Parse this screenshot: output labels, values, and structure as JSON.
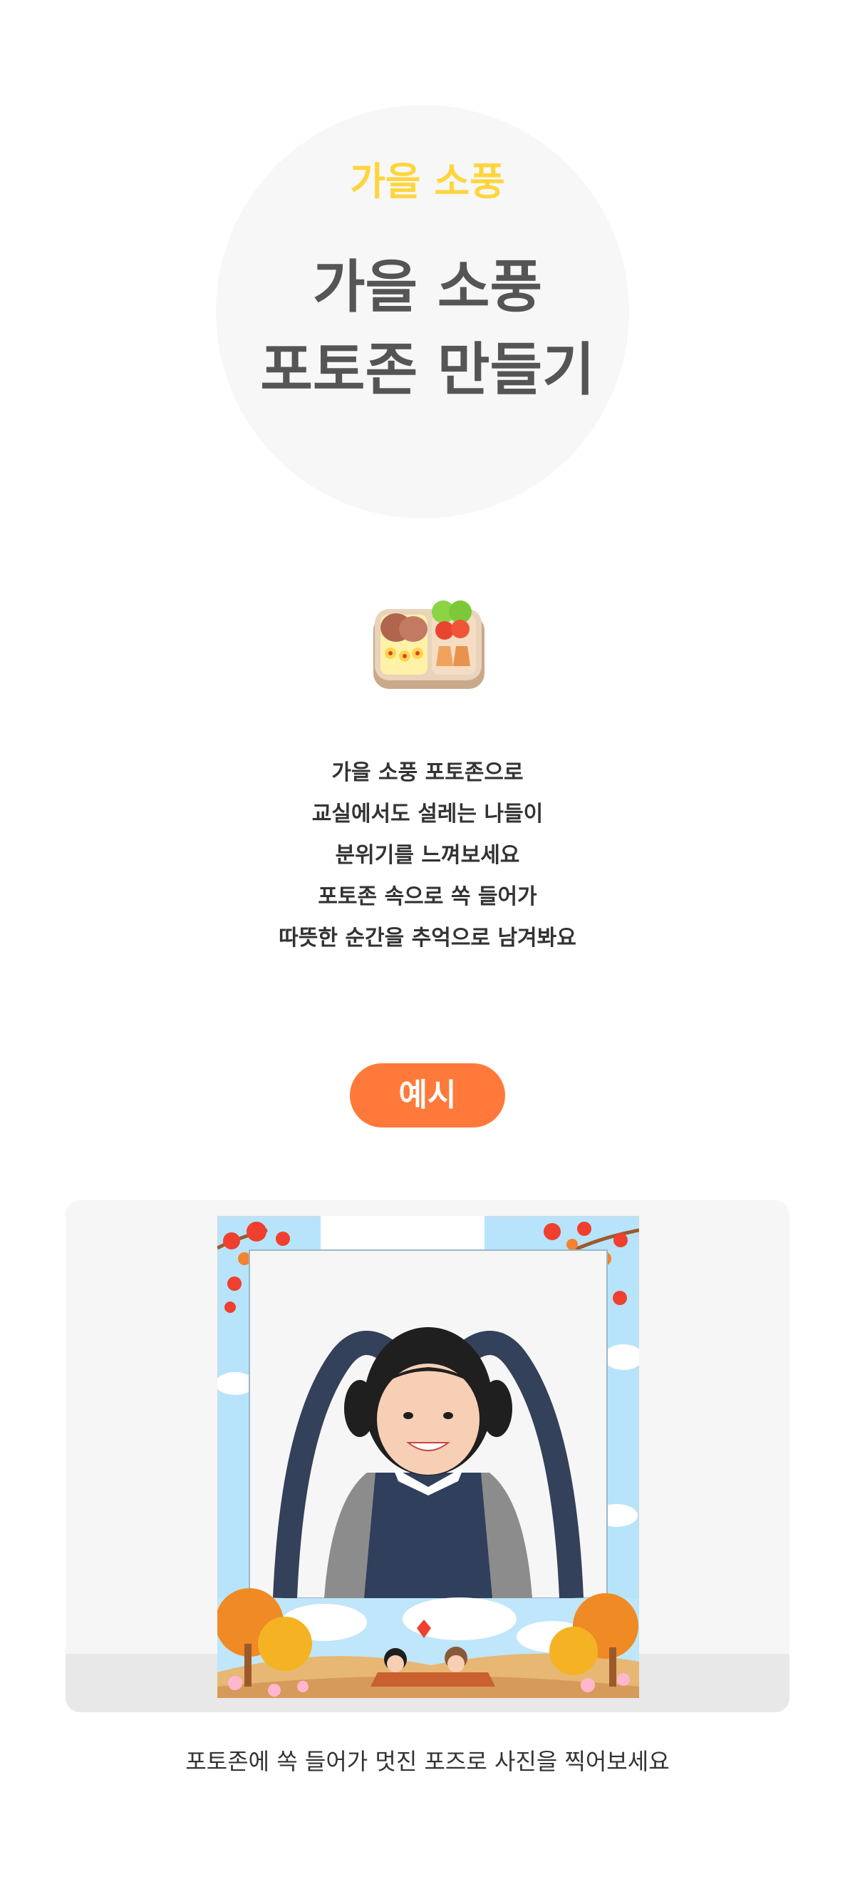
{
  "hero": {
    "eyebrow": "가을 소풍",
    "title_line1": "가을 소풍",
    "title_line2": "포토존 만들기"
  },
  "icons": {
    "lunchbox": "lunchbox-icon"
  },
  "description": {
    "lines": [
      "가을 소풍 포토존으로",
      "교실에서도 설레는 나들이",
      "분위기를 느껴보세요",
      "포토존 속으로 쏙 들어가",
      "따뜻한 순간을 추억으로 남겨봐요"
    ]
  },
  "example": {
    "badge": "예시",
    "caption": "포토존에 쏙 들어가 멋진 포즈로 사진을 찍어보세요"
  },
  "colors": {
    "accent_yellow": "#ffd53e",
    "accent_orange": "#ff7a3a",
    "title_gray": "#555555",
    "sky_blue": "#b7e4fb"
  }
}
